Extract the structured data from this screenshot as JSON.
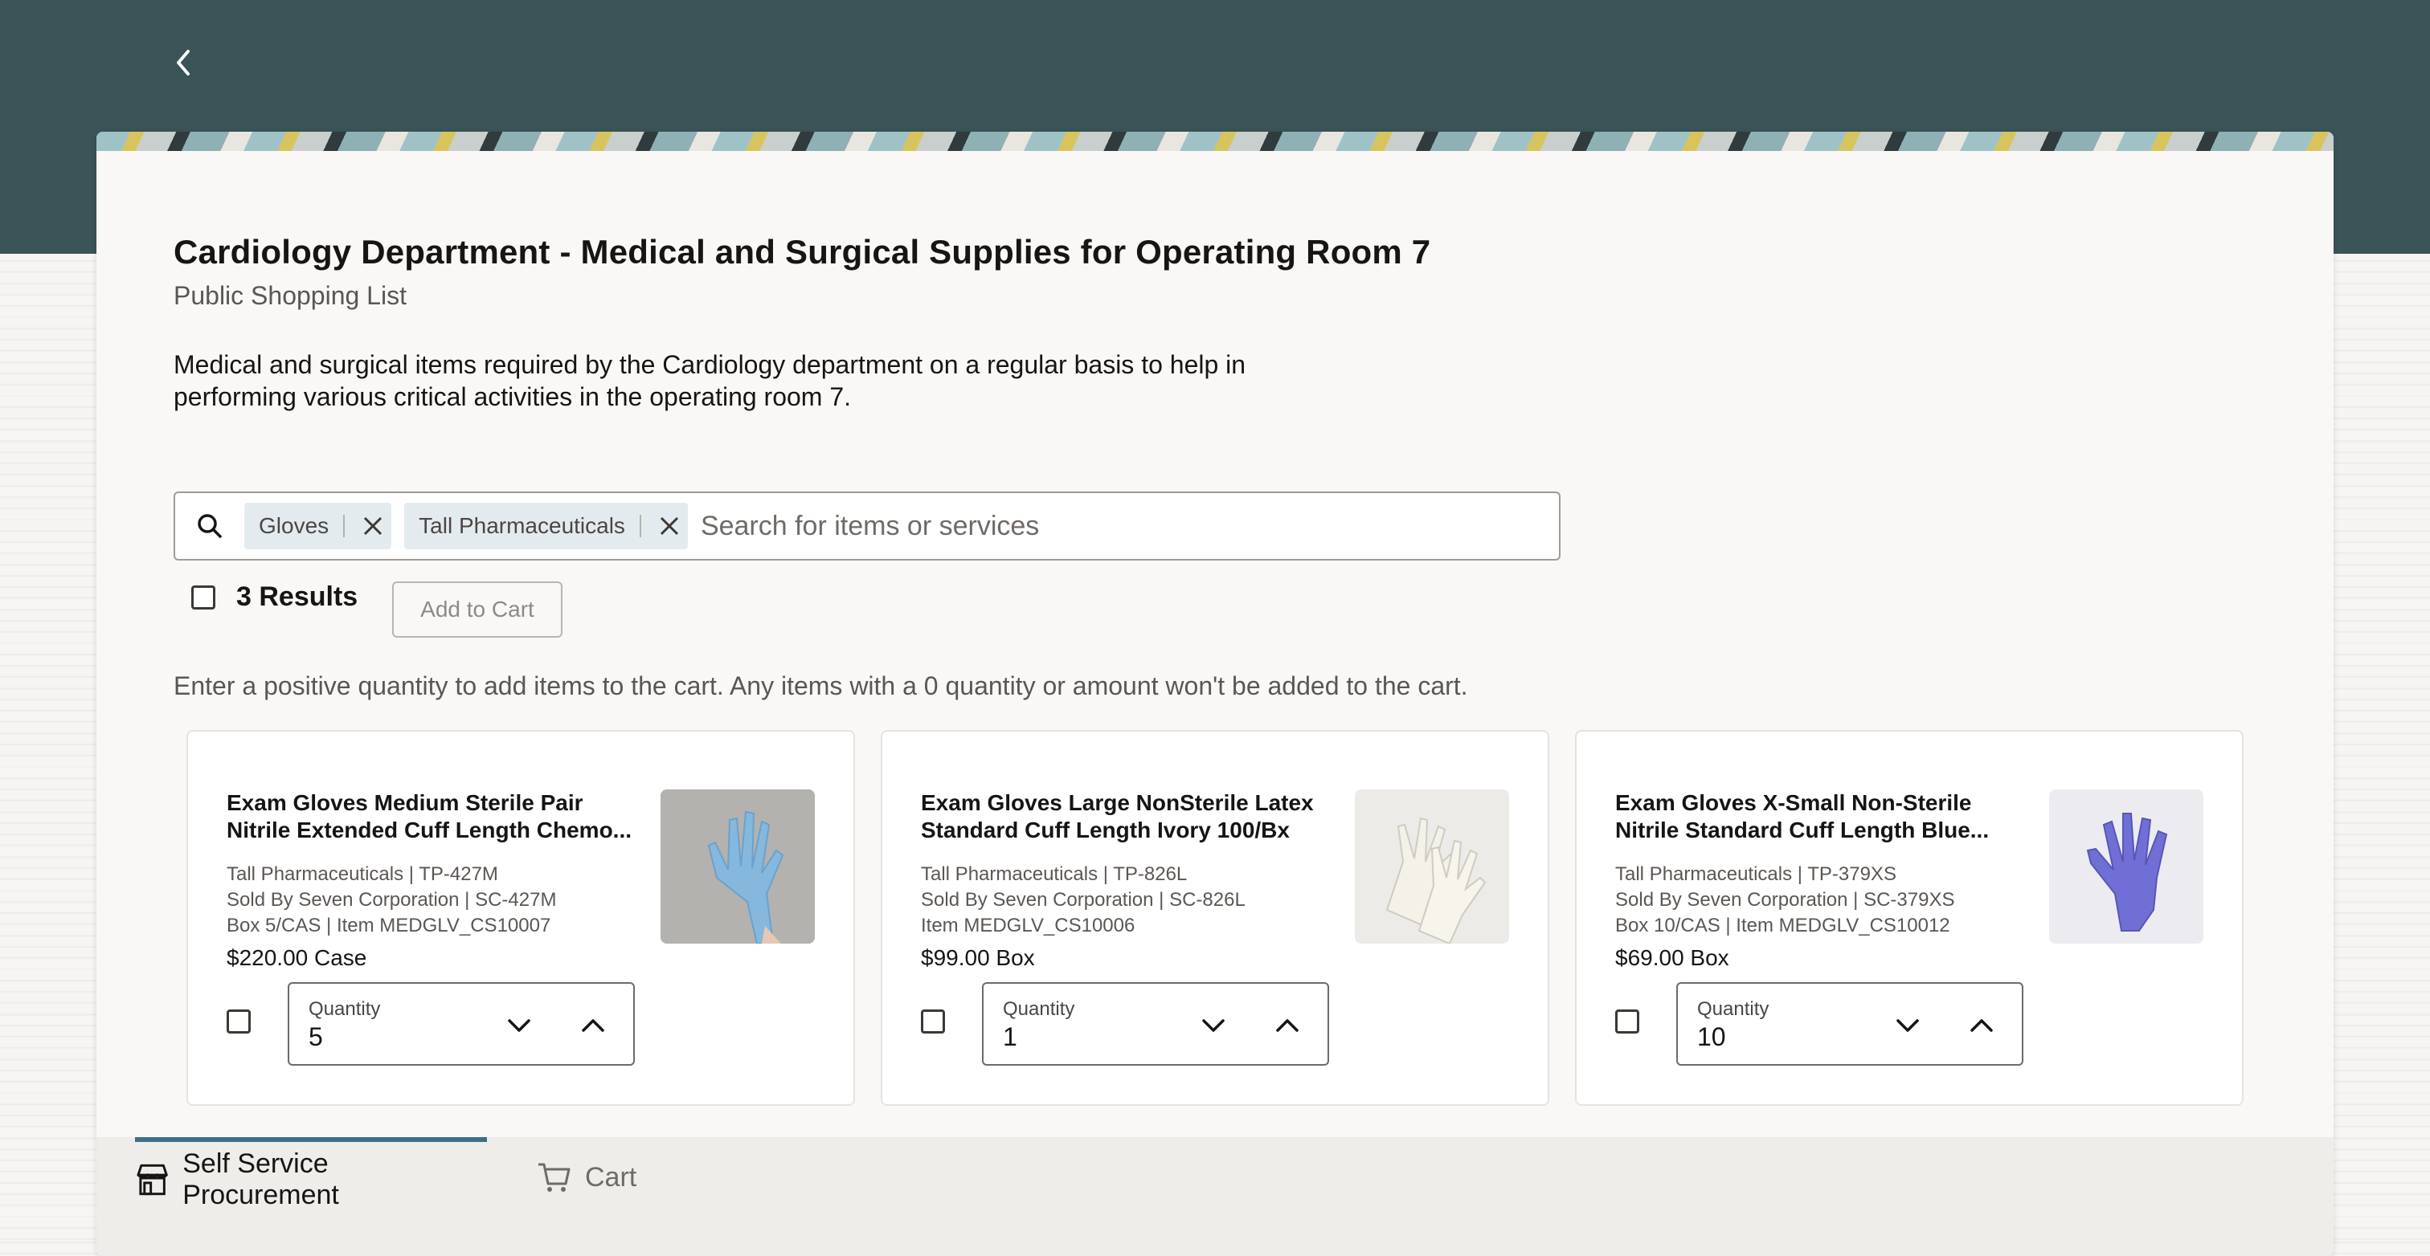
{
  "header": {
    "back_icon": "chevron-left-icon"
  },
  "list": {
    "title": "Cardiology Department - Medical and Surgical Supplies for Operating Room 7",
    "subtitle": "Public Shopping List",
    "description": "Medical and surgical items required by the Cardiology department on a regular basis to help in performing various critical activities in the operating room 7."
  },
  "search": {
    "icon": "search-icon",
    "placeholder": "Search for items or services",
    "value": "",
    "chips": [
      {
        "label": "Gloves"
      },
      {
        "label": "Tall Pharmaceuticals"
      }
    ]
  },
  "results": {
    "count_label": "3 Results",
    "add_to_cart_label": "Add to Cart",
    "hint": "Enter a positive quantity to add items to the cart. Any items with a 0 quantity or amount won't be added to the cart."
  },
  "products": [
    {
      "name_line1": "Exam Gloves Medium Sterile Pair",
      "name_line2": "Nitrile Extended Cuff Length Chemo...",
      "meta1": "Tall Pharmaceuticals | TP-427M",
      "meta2": "Sold By Seven Corporation | SC-427M",
      "meta3": "Box 5/CAS | Item MEDGLV_CS10007",
      "price": "$220.00 Case",
      "qty_label": "Quantity",
      "qty_value": "5",
      "image_color": "#86b8de"
    },
    {
      "name_line1": "Exam Gloves Large NonSterile Latex",
      "name_line2": "Standard Cuff Length Ivory 100/Bx",
      "meta1": "Tall Pharmaceuticals | TP-826L",
      "meta2": "Sold By Seven Corporation | SC-826L",
      "meta3": "Item MEDGLV_CS10006",
      "price": "$99.00 Box",
      "qty_label": "Quantity",
      "qty_value": "1",
      "image_color": "#efece4"
    },
    {
      "name_line1": "Exam Gloves X-Small Non-Sterile",
      "name_line2": "Nitrile Standard Cuff Length Blue...",
      "meta1": "Tall Pharmaceuticals | TP-379XS",
      "meta2": "Sold By Seven Corporation | SC-379XS",
      "meta3": "Box 10/CAS | Item MEDGLV_CS10012",
      "price": "$69.00 Box",
      "qty_label": "Quantity",
      "qty_value": "10",
      "image_color": "#6f6fd6"
    }
  ],
  "nav": {
    "tabs": [
      {
        "label": "Self Service Procurement",
        "icon": "store-icon",
        "active": true
      },
      {
        "label": "Cart",
        "icon": "cart-icon",
        "active": false
      }
    ]
  },
  "colors": {
    "header_bg": "#3a5457",
    "active_tab_accent": "#3a6f8a"
  }
}
